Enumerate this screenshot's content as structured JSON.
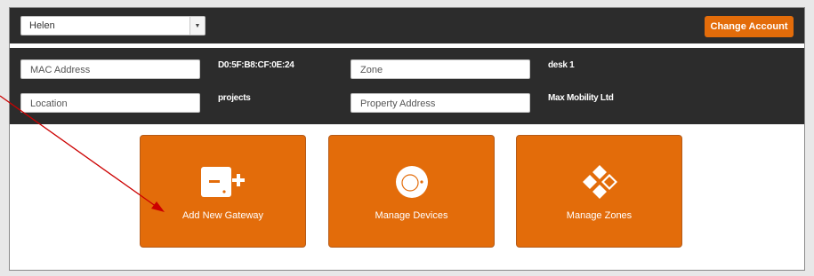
{
  "account": {
    "selected_user": "Helen",
    "change_button_label": "Change Account"
  },
  "info": {
    "mac_address_label": "MAC Address",
    "mac_address_value": "D0:5F:B8:CF:0E:24",
    "zone_label": "Zone",
    "zone_value": "desk 1",
    "location_label": "Location",
    "location_value": "projects",
    "property_address_label": "Property Address",
    "property_address_value": "Max Mobility Ltd"
  },
  "tiles": [
    {
      "label": "Add New Gateway",
      "icon": "add-gateway-icon"
    },
    {
      "label": "Manage Devices",
      "icon": "device-icon"
    },
    {
      "label": "Manage Zones",
      "icon": "zones-icon"
    }
  ],
  "colors": {
    "accent": "#e36c0a",
    "dark_bar": "#2c2c2c",
    "annotation_arrow": "#cc0000"
  }
}
